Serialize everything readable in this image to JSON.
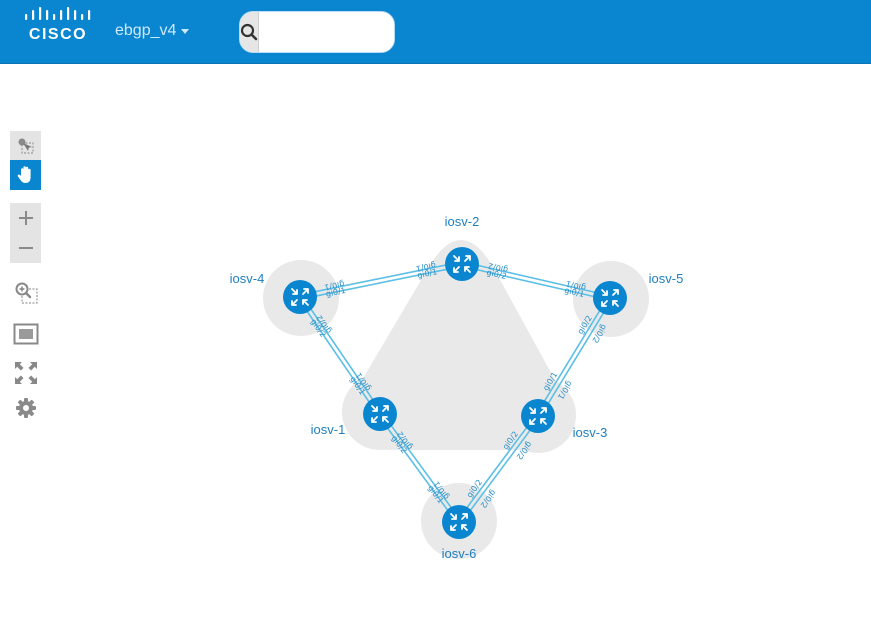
{
  "header": {
    "logo_text": "CISCO",
    "project_name": "ebgp_v4",
    "search_placeholder": "",
    "search_value": ""
  },
  "toolbar": {
    "tools": [
      {
        "name": "select-tool",
        "icon": "selection-pointer-icon",
        "active": false
      },
      {
        "name": "pan-tool",
        "icon": "hand-icon",
        "active": true
      },
      {
        "name": "zoom-in",
        "icon": "plus-icon",
        "active": false
      },
      {
        "name": "zoom-out",
        "icon": "minus-icon",
        "active": false
      },
      {
        "name": "zoom-selection",
        "icon": "zoom-region-icon",
        "active": false
      },
      {
        "name": "fit-to-screen",
        "icon": "fit-screen-icon",
        "active": false
      },
      {
        "name": "fullscreen",
        "icon": "expand-arrows-icon",
        "active": false
      },
      {
        "name": "settings",
        "icon": "gear-icon",
        "active": false
      }
    ]
  },
  "topology": {
    "nodes": [
      {
        "id": "iosv-1",
        "label": "iosv-1",
        "icon": "router-icon"
      },
      {
        "id": "iosv-2",
        "label": "iosv-2",
        "icon": "router-icon"
      },
      {
        "id": "iosv-3",
        "label": "iosv-3",
        "icon": "router-icon"
      },
      {
        "id": "iosv-4",
        "label": "iosv-4",
        "icon": "router-icon"
      },
      {
        "id": "iosv-5",
        "label": "iosv-5",
        "icon": "router-icon"
      },
      {
        "id": "iosv-6",
        "label": "iosv-6",
        "icon": "router-icon"
      }
    ],
    "links": [
      {
        "from": "iosv-4",
        "to": "iosv-2",
        "from_port": "gi0/1",
        "to_port": "gi0/1"
      },
      {
        "from": "iosv-2",
        "to": "iosv-5",
        "from_port": "gi0/2",
        "to_port": "gi0/1"
      },
      {
        "from": "iosv-4",
        "to": "iosv-1",
        "from_port": "gi0/2",
        "to_port": "gi0/1"
      },
      {
        "from": "iosv-5",
        "to": "iosv-3",
        "from_port": "gi0/2",
        "to_port": "gi0/1"
      },
      {
        "from": "iosv-1",
        "to": "iosv-6",
        "from_port": "gi0/2",
        "to_port": "gi0/1"
      },
      {
        "from": "iosv-3",
        "to": "iosv-6",
        "from_port": "gi0/2",
        "to_port": "gi0/2"
      }
    ],
    "colors": {
      "node": "#0a86d0",
      "link": "#5bbfe6",
      "group": "#e9e9e9",
      "label": "#1f80c0"
    }
  }
}
